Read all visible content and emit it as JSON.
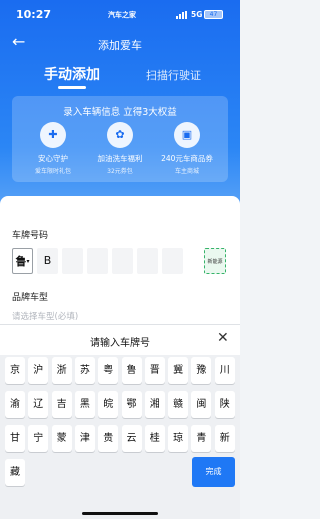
{
  "status_bar": {
    "time": "10:27",
    "carrier": "汽车之家",
    "network": "5G",
    "battery": "47"
  },
  "nav": {
    "title": "添加爱车"
  },
  "tabs": {
    "manual": "手动添加",
    "scan": "扫描行驶证"
  },
  "promo": {
    "title": "录入车辆信息 立得3大权益",
    "benefits": [
      {
        "name": "安心守护",
        "sub": "爱车限时礼包",
        "icon": "shield-icon"
      },
      {
        "name": "加油洗车福利",
        "sub": "32元券包",
        "icon": "gift-icon"
      },
      {
        "name": "240元车商品券",
        "sub": "车主商城",
        "icon": "shop-icon"
      }
    ]
  },
  "form": {
    "plate_label": "车牌号码",
    "plate_chars": [
      "鲁",
      "B",
      "",
      "",
      "",
      "",
      ""
    ],
    "new_energy": "新能源",
    "model_label": "品牌车型",
    "model_placeholder": "请选择车型(必填)"
  },
  "keyboard": {
    "title": "请输入车牌号",
    "row1": [
      "京",
      "沪",
      "浙",
      "苏",
      "粤",
      "鲁",
      "晋",
      "冀",
      "豫",
      "川"
    ],
    "row2": [
      "渝",
      "辽",
      "吉",
      "黑",
      "皖",
      "鄂",
      "湘",
      "赣",
      "闽",
      "陕"
    ],
    "row3": [
      "甘",
      "宁",
      "蒙",
      "津",
      "贵",
      "云",
      "桂",
      "琼",
      "青",
      "新"
    ],
    "row4": [
      "藏"
    ],
    "done": "完成"
  },
  "colors": {
    "accent": "#1f78f5",
    "hero": "#1a6cf0",
    "new_energy": "#36b36a"
  }
}
